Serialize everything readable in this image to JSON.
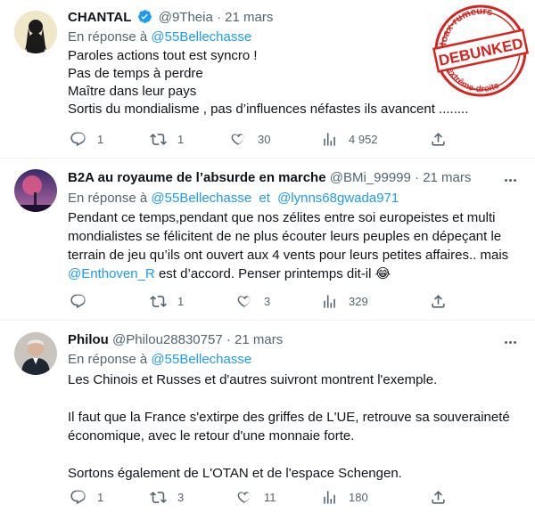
{
  "tweets": [
    {
      "name": "CHANTAL",
      "verified": true,
      "handle": "@9Theia",
      "separator": "·",
      "date": "21 mars",
      "reply_prefix": "En réponse à",
      "reply_to": [
        "@55Bellechasse"
      ],
      "reply_joiner": "",
      "lines": [
        "Paroles actions tout est syncro !",
        "Pas de temps à perdre",
        "Maître dans leur pays",
        "Sortis du mondialisme , pas d’influences néfastes ils avancent ........"
      ],
      "stats": {
        "replies": "1",
        "retweets": "1",
        "likes": "30",
        "views": "4 952"
      }
    },
    {
      "name": "B2A au royaume de l’absurde en marche",
      "verified": false,
      "handle": "@BMi_99999",
      "separator": "·",
      "date": "21 mars",
      "reply_prefix": "En réponse à",
      "reply_to": [
        "@55Bellechasse",
        "@lynns68gwada971"
      ],
      "reply_joiner": "et",
      "body_before": "Pendant ce temps,pendant que nos zélites entre soi europeistes et multi mondialistes se félicitent de ne plus écouter leurs peuples en dépeçant le terrain de jeu qu’ils ont ouvert aux 4 vents pour leurs petites affaires.. mais ",
      "body_mention": "@Enthoven_R",
      "body_after": " est d’accord. Penser printemps dit-il ",
      "body_emoji": "😂",
      "stats": {
        "replies": "",
        "retweets": "1",
        "likes": "3",
        "views": "329"
      }
    },
    {
      "name": "Philou",
      "verified": false,
      "handle": "@Philou28830757",
      "separator": "·",
      "date": "21 mars",
      "reply_prefix": "En réponse à",
      "reply_to": [
        "@55Bellechasse"
      ],
      "reply_joiner": "",
      "paragraphs": [
        "Les Chinois et Russes et d'autres suivront montrent l'exemple.",
        "Il faut que la France s'extirpe des griffes de L'UE, retrouve sa souveraineté économique, avec le retour d'une monnaie forte.",
        "Sortons également de L'OTAN et de l'espace Schengen."
      ],
      "stats": {
        "replies": "1",
        "retweets": "3",
        "likes": "11",
        "views": "180"
      }
    }
  ],
  "stamp": {
    "top_text": "Hoax-rumeurs",
    "center_text": "DEBUNKED",
    "bottom_text": "d'extrême-droite",
    "color": "#d6241f"
  },
  "icons": [
    "reply-icon",
    "retweet-icon",
    "like-icon",
    "views-icon",
    "share-icon",
    "more-icon",
    "verified-icon"
  ],
  "colors": {
    "link": "#1d9bf0",
    "muted": "#536471",
    "text": "#0f1419",
    "divider": "#eff3f4"
  }
}
